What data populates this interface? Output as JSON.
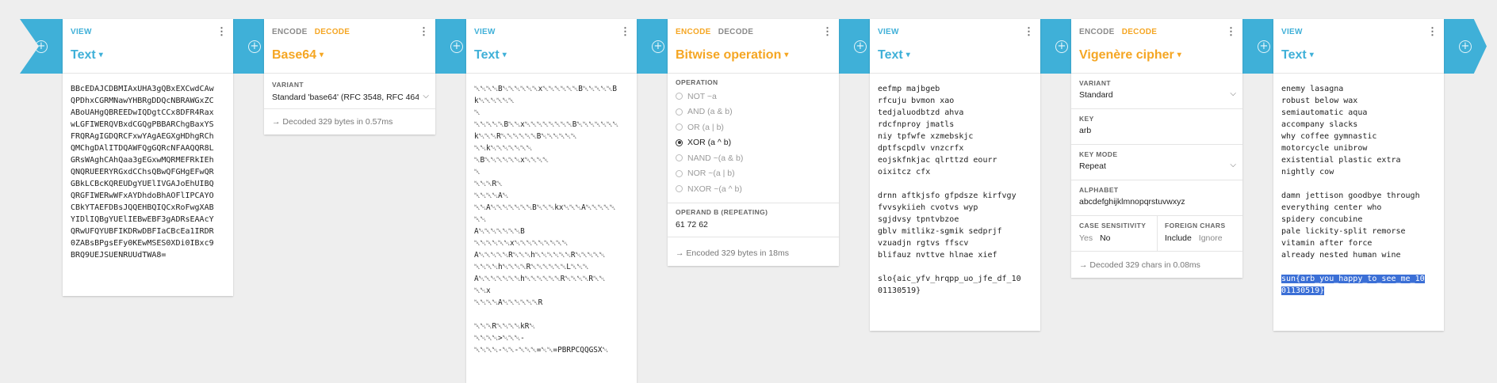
{
  "cards": {
    "c1": {
      "tab": "VIEW",
      "title": "Text",
      "lines": [
        "BBcEDAJCDBMIAxUHA3gQBxEXCwdCAw",
        "QPDhxCGRMNawYHBRgDDQcNBRAWGxZC",
        "ABoUAHgQBREEDwIQDgtCCx8DFR4Rax",
        "wLGFIWERQVBxdCGQgPBBARChgBaxYS",
        "FRQRAgIGDQRCFxwYAgAEGXgHDhgRCh",
        "QMChgDAlITDQAWFQgGQRcNFAAQQR8L",
        "GRsWAghCAhQaa3gEGxwMQRMEFRkIEh",
        "QNQRUEERYRGxdCChsQBwQFGHgEFwQR",
        "GBkLCBcKQREUDgYUElIVGAJoEhUIBQ",
        "QRGFIWERwWFxAYDhdoBhAOFlIPCAYO",
        "CBkYTAEFDBsJQQEHBQIQCxRoFwgXAB",
        "YIDlIQBgYUElIEBwEBF3gADRsEAAcY",
        "QRwUFQYUBFIKDRwDBFIaCBcEa1IRDR",
        "0ZABsBPgsEFy0KEwMSES0XDi0IBxc9",
        "BRQ9UEJSUENRUUdTWA8="
      ]
    },
    "c2": {
      "tab_encode": "ENCODE",
      "tab_decode": "DECODE",
      "title": "Base64",
      "variant_label": "VARIANT",
      "variant_value": "Standard 'base64' (RFC 3548, RFC 4648)",
      "status": "Decoded 329 bytes in 0.57ms"
    },
    "c3": {
      "tab": "VIEW",
      "title": "Text",
      "lines": [
        "␀␀␀␀B␀␀␀␀␀␀x␀␀␀␀␀␀B␀␀␀␀␀B",
        "k␀␀␀␀␀␀",
        "␀",
        "␀␀␀␀␀B␀␀x␀␀␀␀␀␀␀␀B␀␀␀␀␀␀␀",
        "k␀␀␀R␀␀␀␀␀␀B␀␀␀␀␀␀",
        "␀␀k␀␀␀␀␀␀␀",
        "␀B␀␀␀␀␀␀x␀␀␀␀",
        "␀",
        "␀␀␀R␀",
        "␀␀␀␀A␀",
        "␀␀A␀␀␀␀␀␀␀B␀␀␀kx␀␀␀A␀␀␀␀␀",
        "␀␀",
        "A␀␀␀␀␀␀␀B",
        "␀␀␀␀␀␀x␀␀␀␀␀␀␀␀␀",
        "A␀␀␀␀␀R␀␀␀h␀␀␀␀␀␀R␀␀␀␀␀",
        "␀␀␀␀h␀␀␀␀R␀␀␀␀␀␀L␀␀␀",
        "A␀␀␀␀␀␀␀h␀␀␀␀␀␀R␀␀␀␀R␀␀",
        "␀␀x",
        "␀␀␀␀A␀␀␀␀␀␀R",
        "",
        "␀␀␀R␀␀␀␀kR␀",
        "␀␀␀␀>␀␀␀-",
        "␀␀␀␀-␀␀-␀␀␀=␀␀=PBRPCQQGSX␀"
      ]
    },
    "c4": {
      "tab_encode": "ENCODE",
      "tab_decode": "DECODE",
      "title": "Bitwise operation",
      "operation_label": "OPERATION",
      "operations": [
        "NOT ~a",
        "AND (a & b)",
        "OR (a | b)",
        "XOR (a ^ b)",
        "NAND ~(a & b)",
        "NOR ~(a | b)",
        "NXOR ~(a ^ b)"
      ],
      "selected": "XOR (a ^ b)",
      "operand_label": "OPERAND B (REPEATING)",
      "operand_value": "61 72 62",
      "status": "Encoded 329 bytes in 18ms"
    },
    "c5": {
      "tab": "VIEW",
      "title": "Text",
      "lines": [
        "eefmp majbgeb",
        "rfcuju bvmon xao",
        "tedjaluodbtzd ahva",
        "rdcfnproy jmatls",
        "niy tpfwfe xzmebskjc",
        "dptfscpdlv vnzcrfx",
        "eojskfnkjac qlrttzd eourr",
        "oixitcz cfx",
        "",
        "drnn aftkjsfo gfpdsze kirfvgy",
        "fvvsykiieh cvotvs wyp",
        "sgjdvsy tpntvbzoe",
        "gblv mitlikz-sgmik sedprjf",
        "vzuadjn rgtvs ffscv",
        "blifauz nvttve hlnae xief",
        "",
        "slo{aic_yfv_hrqpp_uo_jfe_df_10",
        "01130519}"
      ]
    },
    "c6": {
      "tab_encode": "ENCODE",
      "tab_decode": "DECODE",
      "title": "Vigenère cipher",
      "variant_label": "VARIANT",
      "variant_value": "Standard",
      "key_label": "KEY",
      "key_value": "arb",
      "keymode_label": "KEY MODE",
      "keymode_value": "Repeat",
      "alphabet_label": "ALPHABET",
      "alphabet_value": "abcdefghijklmnopqrstuvwxyz",
      "case_label": "CASE SENSITIVITY",
      "case_yes": "Yes",
      "case_no": "No",
      "foreign_label": "FOREIGN CHARS",
      "foreign_include": "Include",
      "foreign_ignore": "Ignore",
      "status": "Decoded 329 chars in 0.08ms"
    },
    "c7": {
      "tab": "VIEW",
      "title": "Text",
      "lines": [
        "enemy lasagna",
        "robust below wax",
        "semiautomatic aqua",
        "accompany slacks",
        "why coffee gymnastic",
        "motorcycle unibrow",
        "existential plastic extra",
        "nightly cow",
        "",
        "damn jettison goodbye through",
        "everything center who",
        "spidery concubine",
        "pale lickity-split remorse",
        "vitamin after force",
        "already nested human wine"
      ],
      "selected_line1": "sun{arb_you_happy_to_see_me_10",
      "selected_line2": "01130519}"
    }
  },
  "arrow": "→",
  "plus": "+",
  "caret": "▾",
  "dots": "⋮",
  "select_arrow": "⌵"
}
